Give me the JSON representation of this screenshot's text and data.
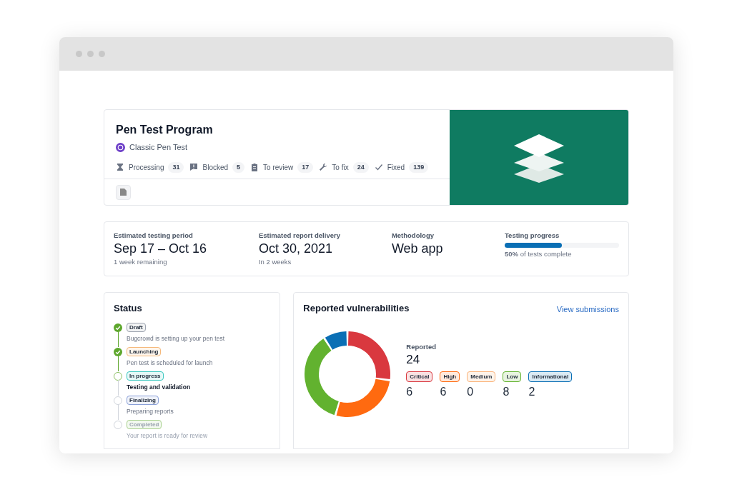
{
  "program": {
    "title": "Pen Test Program",
    "type": "Classic Pen Test",
    "counts": [
      {
        "kind": "hourglass",
        "label": "Processing",
        "count": "31"
      },
      {
        "kind": "blocked",
        "label": "Blocked",
        "count": "5"
      },
      {
        "kind": "review",
        "label": "To review",
        "count": "17"
      },
      {
        "kind": "wrench",
        "label": "To fix",
        "count": "24"
      },
      {
        "kind": "check",
        "label": "Fixed",
        "count": "139"
      }
    ]
  },
  "summary": [
    {
      "kind": "text",
      "label": "Estimated testing period",
      "value": "Sep 17 – Oct 16",
      "note": "1 week remaining"
    },
    {
      "kind": "text",
      "label": "Estimated report delivery",
      "value": "Oct 30, 2021",
      "note": "In 2 weeks"
    },
    {
      "kind": "text",
      "label": "Methodology",
      "value": "Web app"
    },
    {
      "kind": "progress",
      "label": "Testing progress",
      "level": 0.5,
      "note": "**50%** of tests complete"
    }
  ],
  "status": {
    "title": "Status",
    "steps": [
      {
        "kind": "done",
        "tag": "Draft",
        "color": "#9ca3af",
        "text": "Bugcrowd is setting up your pen test"
      },
      {
        "kind": "done",
        "tag": "Launching",
        "color": "#f5b87a",
        "text": "Pen test is scheduled for launch"
      },
      {
        "kind": "current",
        "tag": "In progress",
        "color": "#3cc8c0",
        "text": "Testing and validation"
      },
      {
        "kind": "pending",
        "tag": "Finalizing",
        "color": "#8aa0d8",
        "text": "Preparing reports"
      },
      {
        "kind": "pending",
        "tag": "Completed",
        "color": "#a7d08c",
        "text": "Your report is ready for review"
      }
    ]
  },
  "vulnerabilities": {
    "title": "Reported vulnerabilities",
    "link": "View submissions",
    "total_label": "Reported",
    "total": "24",
    "severities": [
      {
        "label": "Critical",
        "count": "6",
        "color": "#d9383f"
      },
      {
        "label": "High",
        "count": "6",
        "color": "#ff6a10"
      },
      {
        "label": "Medium",
        "count": "0",
        "color": "#fbb37a"
      },
      {
        "label": "Low",
        "count": "8",
        "color": "#62b22f"
      },
      {
        "label": "Informational",
        "count": "2",
        "color": "#0a6fb5"
      }
    ]
  }
}
